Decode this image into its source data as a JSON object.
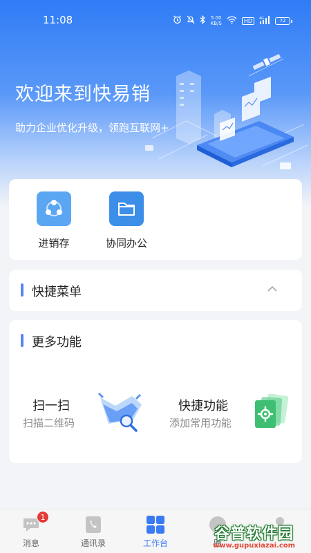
{
  "status_bar": {
    "time": "11:08",
    "network_speed": "5.00",
    "network_speed_unit": "KB/S",
    "hd_label": "HD",
    "signal_label": "4G",
    "battery": "72"
  },
  "hero": {
    "title": "欢迎来到快易销",
    "subtitle": "助力企业优化升级，领跑互联网+"
  },
  "apps": [
    {
      "label": "进销存",
      "icon": "share-nodes-icon",
      "color": "#5aa6f3"
    },
    {
      "label": "协同办公",
      "icon": "folder-icon",
      "color": "#3c8ee8"
    }
  ],
  "quick_menu": {
    "title": "快捷菜单",
    "state": "expanded"
  },
  "more_features": {
    "title": "更多功能",
    "items": [
      {
        "title": "扫一扫",
        "subtitle": "扫描二维码",
        "icon": "scan-magnifier-icon"
      },
      {
        "title": "快捷功能",
        "subtitle": "添加常用功能",
        "icon": "settings-cards-icon"
      }
    ]
  },
  "tabbar": {
    "items": [
      {
        "label": "消息",
        "icon": "chat-bubble-icon",
        "badge": "1"
      },
      {
        "label": "通讯录",
        "icon": "phone-book-icon"
      },
      {
        "label": "工作台",
        "icon": "grid-icon",
        "active": true
      },
      {
        "label": "圈",
        "icon": "circle-icon"
      },
      {
        "label": "",
        "icon": "person-icon"
      }
    ]
  },
  "watermark": {
    "main": "谷普软件园",
    "sub": "www.gupuxiazai.com"
  },
  "colors": {
    "brand_blue": "#2f7cf6",
    "active_tab": "#3a7af3",
    "section_accent": "#5b83f5",
    "badge_red": "#e53935"
  }
}
